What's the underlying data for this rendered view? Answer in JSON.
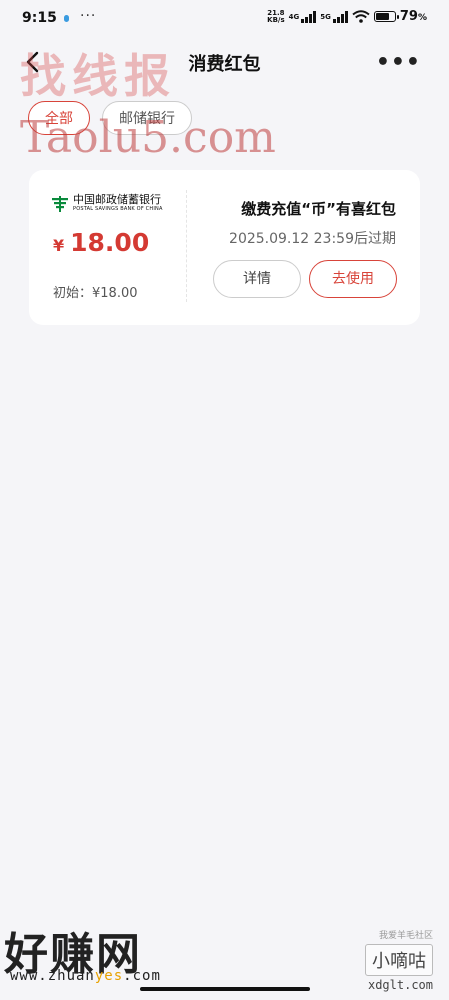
{
  "status_bar": {
    "time": "9:15",
    "network_speed_value": "21.8",
    "network_speed_unit": "KB/s",
    "net1": "4G",
    "net2": "5G",
    "battery_percent": "79",
    "battery_symbol": "%",
    "battery_level": 0.79
  },
  "header": {
    "title": "消费红包"
  },
  "watermarks": {
    "top_cn": "找线报",
    "top_en": "Taolu5.com",
    "bottom_cn": "好赚网",
    "bottom_url_prefix": "www.zhuan",
    "bottom_url_highlight": "yes",
    "bottom_url_suffix": ".com",
    "right_small": "我爱羊毛社区",
    "right_badge": "小嘀咕",
    "right_url": "xdglt.com"
  },
  "tabs": [
    {
      "label": "全部",
      "active": true
    },
    {
      "label": "邮储银行",
      "active": false
    }
  ],
  "coupon": {
    "bank_name_cn": "中国邮政储蓄银行",
    "bank_name_en": "POSTAL SAVINGS BANK OF CHINA",
    "currency": "¥",
    "amount": "18.00",
    "initial_label": "初始：",
    "initial_value": "¥18.00",
    "name": "缴费充值“币”有喜红包",
    "expiry": "2025.09.12 23:59后过期",
    "detail_label": "详情",
    "use_label": "去使用"
  },
  "colors": {
    "accent": "#d8443a",
    "amount": "#d43a33",
    "background": "#f5f5f8",
    "bank_green": "#0a8a3c"
  }
}
